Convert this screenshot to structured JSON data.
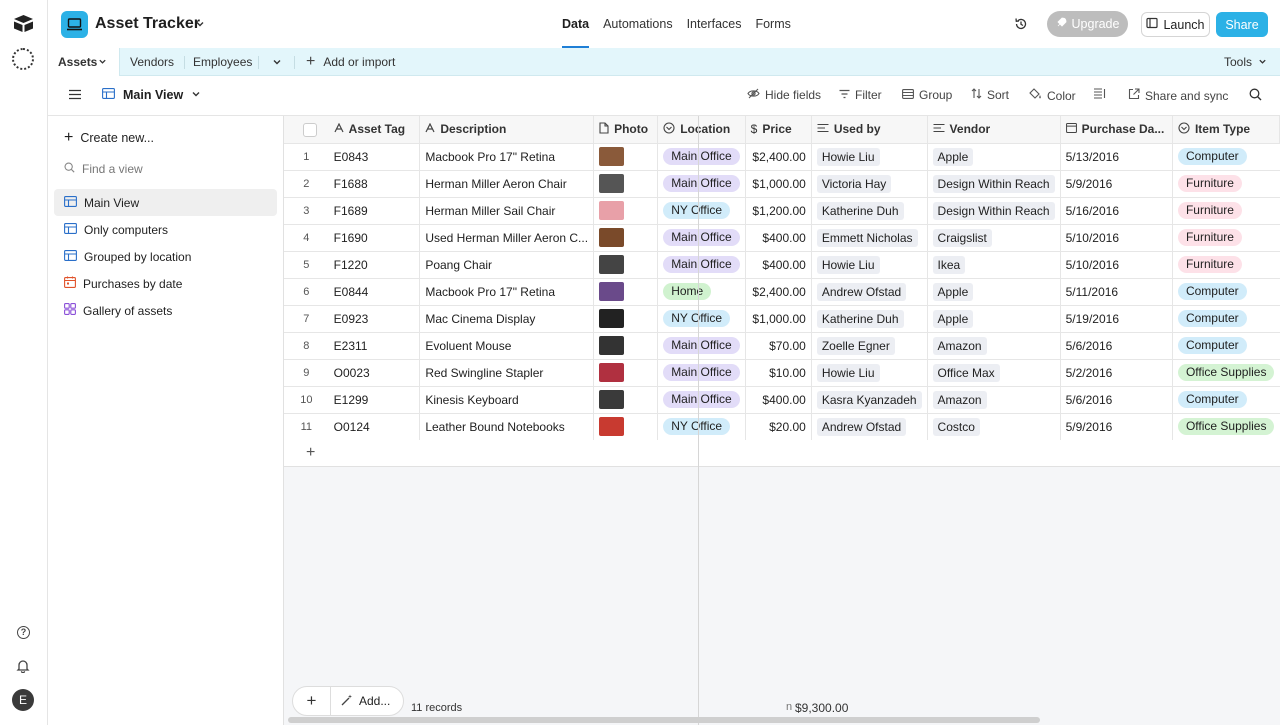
{
  "topbar": {
    "title": "Asset Tracker",
    "nav": [
      {
        "label": "Data",
        "active": true
      },
      {
        "label": "Automations",
        "active": false
      },
      {
        "label": "Interfaces",
        "active": false
      },
      {
        "label": "Forms",
        "active": false
      }
    ],
    "upgrade_label": "Upgrade",
    "launch_label": "Launch",
    "share_label": "Share"
  },
  "rail": {
    "avatar_initial": "E"
  },
  "tables": {
    "active": "Assets",
    "others": [
      "Vendors",
      "Employees"
    ],
    "add_label": "Add or import",
    "tools_label": "Tools"
  },
  "viewbar": {
    "view_name": "Main View",
    "hide_fields": "Hide fields",
    "filter": "Filter",
    "group": "Group",
    "sort": "Sort",
    "color": "Color",
    "share_sync": "Share and sync"
  },
  "sidebar": {
    "create_new": "Create new...",
    "find_placeholder": "Find a view",
    "views": [
      {
        "label": "Main View",
        "icon": "grid-icon",
        "active": true
      },
      {
        "label": "Only computers",
        "icon": "grid-icon",
        "active": false
      },
      {
        "label": "Grouped by location",
        "icon": "grid-icon",
        "active": false
      },
      {
        "label": "Purchases by date",
        "icon": "calendar-icon",
        "active": false
      },
      {
        "label": "Gallery of assets",
        "icon": "gallery-icon",
        "active": false
      }
    ]
  },
  "colors": {
    "accent": "#2cb1e6",
    "main_office": "#e2dcf8",
    "ny_office": "#d1ecfa",
    "home": "#d0f2cf",
    "computer": "#d1ecfa",
    "furniture": "#fde1e8",
    "office_supplies": "#d4f3d3"
  },
  "grid": {
    "columns": [
      "Asset Tag",
      "Description",
      "Photo",
      "Location",
      "Price",
      "Used by",
      "Vendor",
      "Purchase Da...",
      "Item Type"
    ],
    "rows": [
      {
        "n": "1",
        "tag": "E0843",
        "desc": "Macbook Pro 17\" Retina",
        "photo": "#8a5a3a",
        "loc": "Main Office",
        "price": "$2,400.00",
        "user": "Howie Liu",
        "vendor": "Apple",
        "date": "5/13/2016",
        "type": "Computer"
      },
      {
        "n": "2",
        "tag": "F1688",
        "desc": "Herman Miller Aeron Chair",
        "photo": "#555555",
        "loc": "Main Office",
        "price": "$1,000.00",
        "user": "Victoria Hay",
        "vendor": "Design Within Reach",
        "date": "5/9/2016",
        "type": "Furniture"
      },
      {
        "n": "3",
        "tag": "F1689",
        "desc": "Herman Miller Sail Chair",
        "photo": "#e8a0a8",
        "loc": "NY Office",
        "price": "$1,200.00",
        "user": "Katherine Duh",
        "vendor": "Design Within Reach",
        "date": "5/16/2016",
        "type": "Furniture"
      },
      {
        "n": "4",
        "tag": "F1690",
        "desc": "Used Herman Miller Aeron C...",
        "photo": "#7a4a2a",
        "loc": "Main Office",
        "price": "$400.00",
        "user": "Emmett Nicholas",
        "vendor": "Craigslist",
        "date": "5/10/2016",
        "type": "Furniture"
      },
      {
        "n": "5",
        "tag": "F1220",
        "desc": "Poang Chair",
        "photo": "#444444",
        "loc": "Main Office",
        "price": "$400.00",
        "user": "Howie Liu",
        "vendor": "Ikea",
        "date": "5/10/2016",
        "type": "Furniture"
      },
      {
        "n": "6",
        "tag": "E0844",
        "desc": "Macbook Pro 17\" Retina",
        "photo": "#6a4a8a",
        "loc": "Home",
        "price": "$2,400.00",
        "user": "Andrew Ofstad",
        "vendor": "Apple",
        "date": "5/11/2016",
        "type": "Computer"
      },
      {
        "n": "7",
        "tag": "E0923",
        "desc": "Mac Cinema Display",
        "photo": "#222222",
        "loc": "NY Office",
        "price": "$1,000.00",
        "user": "Katherine Duh",
        "vendor": "Apple",
        "date": "5/19/2016",
        "type": "Computer"
      },
      {
        "n": "8",
        "tag": "E2311",
        "desc": "Evoluent Mouse",
        "photo": "#333333",
        "loc": "Main Office",
        "price": "$70.00",
        "user": "Zoelle Egner",
        "vendor": "Amazon",
        "date": "5/6/2016",
        "type": "Computer"
      },
      {
        "n": "9",
        "tag": "O0023",
        "desc": "Red Swingline Stapler",
        "photo": "#b03040",
        "loc": "Main Office",
        "price": "$10.00",
        "user": "Howie Liu",
        "vendor": "Office Max",
        "date": "5/2/2016",
        "type": "Office Supplies"
      },
      {
        "n": "10",
        "tag": "E1299",
        "desc": "Kinesis Keyboard",
        "photo": "#3a3a3a",
        "loc": "Main Office",
        "price": "$400.00",
        "user": "Kasra Kyanzadeh",
        "vendor": "Amazon",
        "date": "5/6/2016",
        "type": "Computer"
      },
      {
        "n": "11",
        "tag": "O0124",
        "desc": "Leather Bound Notebooks",
        "photo": "#c83a30",
        "loc": "NY Office",
        "price": "$20.00",
        "user": "Andrew Ofstad",
        "vendor": "Costco",
        "date": "5/9/2016",
        "type": "Office Supplies"
      }
    ]
  },
  "footer": {
    "add_label": "Add...",
    "records": "11 records",
    "sum_prefix": "n",
    "sum": "$9,300.00"
  }
}
